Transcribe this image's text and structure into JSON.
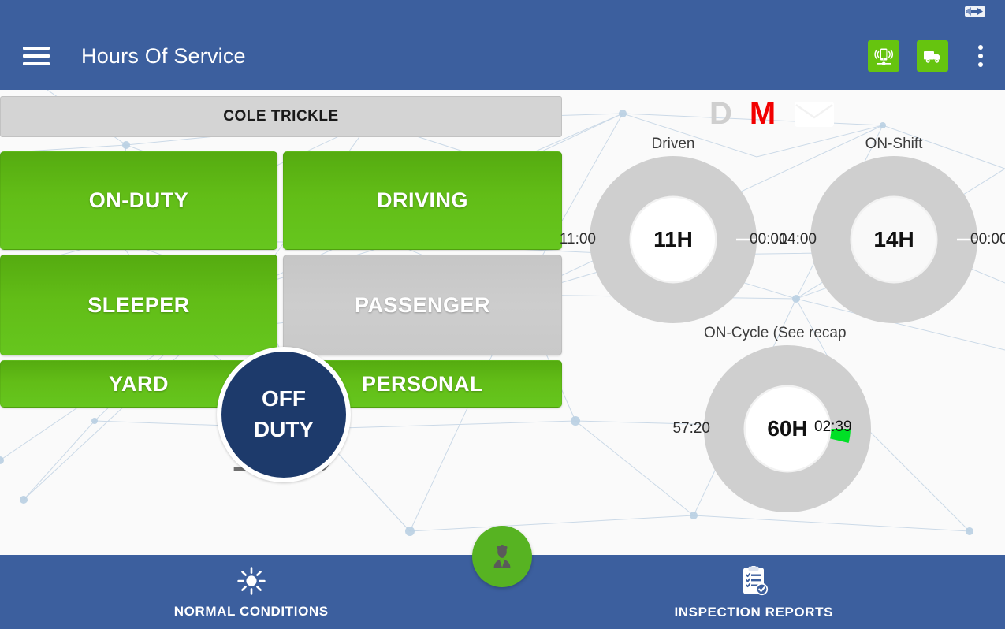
{
  "statusbar": {
    "icon": "back-arrow-indicator-icon"
  },
  "appbar": {
    "menu_icon": "hamburger-menu-icon",
    "title": "Hours Of Service",
    "actions": [
      {
        "name": "device-connection-icon",
        "label": "device-status"
      },
      {
        "name": "vehicle-icon",
        "label": "vehicle-status"
      },
      {
        "name": "overflow-menu-icon",
        "label": "more-options"
      }
    ],
    "accent_green": "#66c40f",
    "bar_blue": "#3c5f9e"
  },
  "driver": {
    "name": "COLE TRICKLE"
  },
  "duty_buttons": [
    {
      "id": "on-duty",
      "label": "ON-DUTY",
      "state": "enabled"
    },
    {
      "id": "driving",
      "label": "DRIVING",
      "state": "enabled"
    },
    {
      "id": "sleeper",
      "label": "SLEEPER",
      "state": "enabled"
    },
    {
      "id": "passenger",
      "label": "PASSENGER",
      "state": "disabled"
    },
    {
      "id": "yard",
      "label": "YARD",
      "state": "enabled"
    },
    {
      "id": "personal",
      "label": "PERSONAL",
      "state": "enabled"
    }
  ],
  "current_status": {
    "line1": "OFF",
    "line2": "DUTY",
    "color": "#1d3a6b"
  },
  "clock": "16:39",
  "flags": [
    {
      "letter": "D",
      "color": "#cfcfcf",
      "active": false
    },
    {
      "letter": "M",
      "color": "#f20000",
      "active": true
    },
    {
      "letter": "",
      "icon": "envelope-icon",
      "color": "#ffffff"
    }
  ],
  "chart_data": [
    {
      "type": "pie",
      "title": "Driven",
      "center_label": "11H",
      "left_label": "11:00",
      "right_label": "00:00",
      "total_hours": 11,
      "used_hours": 0,
      "remaining_hours": 11,
      "used_pct": 0,
      "track_color": "#cfcfcf",
      "progress_color": "#00e026"
    },
    {
      "type": "pie",
      "title": "ON-Shift",
      "center_label": "14H",
      "left_label": "14:00",
      "right_label": "00:00",
      "total_hours": 14,
      "used_hours": 0,
      "remaining_hours": 14,
      "used_pct": 0,
      "track_color": "#cfcfcf",
      "progress_color": "#00e026"
    },
    {
      "type": "pie",
      "title": "ON-Cycle (See recap",
      "center_label": "60H",
      "left_label": "57:20",
      "right_label": "02:39",
      "total_hours": 60,
      "used_hours": 2.65,
      "remaining_hours": 57.33,
      "used_pct": 4.4,
      "track_color": "#cfcfcf",
      "progress_color": "#00e026"
    }
  ],
  "fab": {
    "icon": "officer-icon",
    "color": "#57b322"
  },
  "bottombar": {
    "items": [
      {
        "icon": "sun-icon",
        "label": "NORMAL CONDITIONS"
      },
      {
        "icon": "clipboard-check-icon",
        "label": "INSPECTION REPORTS"
      }
    ]
  }
}
